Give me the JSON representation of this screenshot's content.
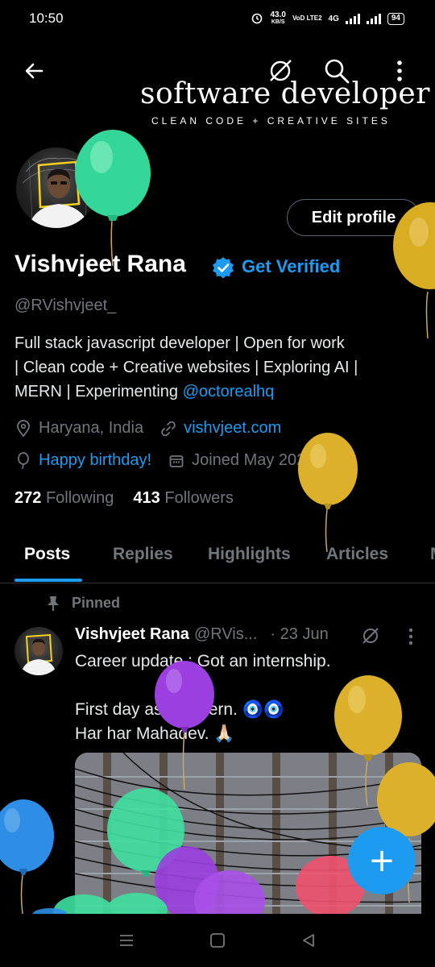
{
  "status_bar": {
    "time": "10:50",
    "net_speed": "43.0",
    "net_unit": "KB/S",
    "volte": "VoD LTE2",
    "network": "4G",
    "battery": "94"
  },
  "banner": {
    "title": "software developer",
    "subtitle": "CLEAN CODE + CREATIVE SITES"
  },
  "toolbar": {
    "back_icon": "arrow-left-icon",
    "grok_icon": "slash-circle-icon",
    "search_icon": "search-icon",
    "more_icon": "more-vertical-icon"
  },
  "profile": {
    "edit_button": "Edit profile",
    "name": "Vishvjeet Rana",
    "get_verified": "Get Verified",
    "handle": "@RVishvjeet_",
    "bio_line1": "Full stack javascript developer | Open for work",
    "bio_line2": "| Clean code + Creative websites | Exploring AI |",
    "bio_line3_prefix": "MERN | Experimenting ",
    "bio_mention": "@octorealhq",
    "location": "Haryana, India",
    "website": "vishvjeet.com",
    "birthday": "Happy birthday!",
    "joined": "Joined May 2024",
    "following_count": "272",
    "following_label": "Following",
    "followers_count": "413",
    "followers_label": "Followers"
  },
  "tabs": [
    {
      "label": "Posts",
      "active": true
    },
    {
      "label": "Replies",
      "active": false
    },
    {
      "label": "Highlights",
      "active": false
    },
    {
      "label": "Articles",
      "active": false
    },
    {
      "label": "M",
      "active": false
    }
  ],
  "tweet": {
    "pinned_label": "Pinned",
    "author": "Vishvjeet Rana",
    "handle": "@RVis...",
    "date": "· 23 Jun",
    "line1": "Career update : Got an internship.",
    "line2": "First day as an intern. 🧿🧿",
    "line3": "Har har Mahadev. 🙏🏻"
  },
  "fab": {
    "label": "+"
  },
  "colors": {
    "accent": "#1d9bf0",
    "background": "#000000",
    "muted": "#71767b",
    "balloon_green": "#3ee0a0",
    "balloon_yellow": "#e0b62a",
    "balloon_purple": "#9b3fe0",
    "balloon_blue": "#2e8ee6",
    "balloon_red": "#f0526e"
  }
}
